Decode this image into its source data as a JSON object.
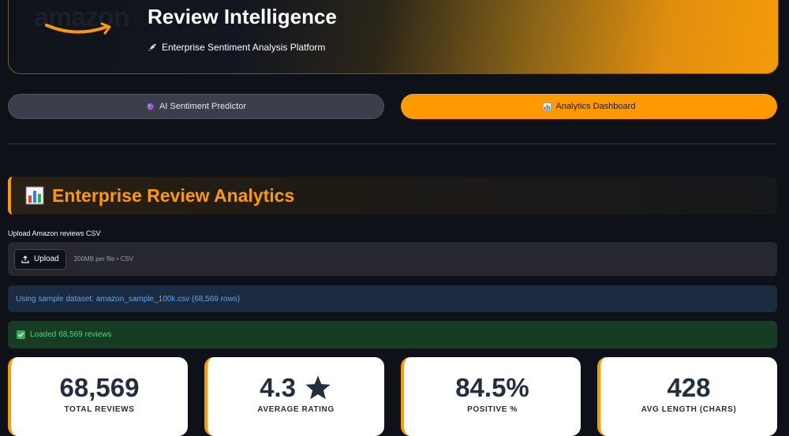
{
  "hero": {
    "logo_text": "amazon",
    "title": "Review Intelligence",
    "subtitle": "Enterprise Sentiment Analysis Platform",
    "subtitle_icon": "rocket-icon"
  },
  "tabs": [
    {
      "label": "AI Sentiment Predictor",
      "icon": "crystal-ball-icon",
      "active": false
    },
    {
      "label": "Analytics Dashboard",
      "icon": "bar-chart-icon",
      "active": true
    }
  ],
  "section": {
    "title": "Enterprise Review Analytics",
    "icon": "bar-chart-icon"
  },
  "uploader": {
    "label": "Upload Amazon reviews CSV",
    "button_label": "Upload",
    "hint": "200MB per file • CSV"
  },
  "info_message": "Using sample dataset: amazon_sample_100k.csv (68,569 rows)",
  "success_message": "Loaded 68,569 reviews",
  "metrics": [
    {
      "value": "68,569",
      "label": "TOTAL REVIEWS"
    },
    {
      "value": "4.3",
      "label": "AVERAGE RATING",
      "icon": "star-icon"
    },
    {
      "value": "84.5%",
      "label": "POSITIVE %"
    },
    {
      "value": "428",
      "label": "AVG LENGTH (CHARS)"
    }
  ],
  "colors": {
    "accent": "#ff9900",
    "background": "#0e1117",
    "info": "#5aa7f5",
    "success": "#4fd27b"
  }
}
